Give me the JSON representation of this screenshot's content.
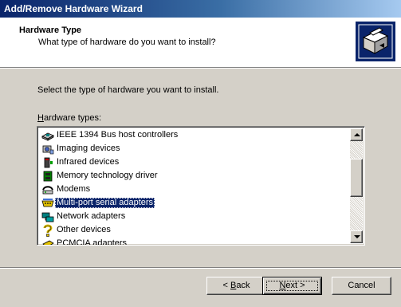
{
  "window": {
    "title": "Add/Remove Hardware Wizard"
  },
  "header": {
    "title": "Hardware Type",
    "subtitle": "What type of hardware do you want to install?"
  },
  "body": {
    "instruction": "Select the type of hardware you want to install.",
    "list_label_accel": "H",
    "list_label_rest": "ardware types:"
  },
  "hardware_list": {
    "items": [
      {
        "label": "IEEE 1394 Bus host controllers",
        "icon": "bus-controller-icon"
      },
      {
        "label": "Imaging devices",
        "icon": "camera-icon"
      },
      {
        "label": "Infrared devices",
        "icon": "infrared-icon"
      },
      {
        "label": "Memory technology driver",
        "icon": "memory-icon"
      },
      {
        "label": "Modems",
        "icon": "modem-icon"
      },
      {
        "label": "Multi-port serial adapters",
        "icon": "serial-adapter-icon"
      },
      {
        "label": "Network adapters",
        "icon": "network-adapter-icon"
      },
      {
        "label": "Other devices",
        "icon": "question-mark-icon"
      },
      {
        "label": "PCMCIA adapters",
        "icon": "pcmcia-icon"
      }
    ],
    "selected": "Multi-port serial adapters"
  },
  "buttons": {
    "back_accel": "B",
    "back_rest": "ack",
    "back_prefix": "< ",
    "next_accel": "N",
    "next_rest": "ext >",
    "cancel": "Cancel"
  },
  "colors": {
    "selection": "#0a246a",
    "face": "#d4d0c8"
  }
}
